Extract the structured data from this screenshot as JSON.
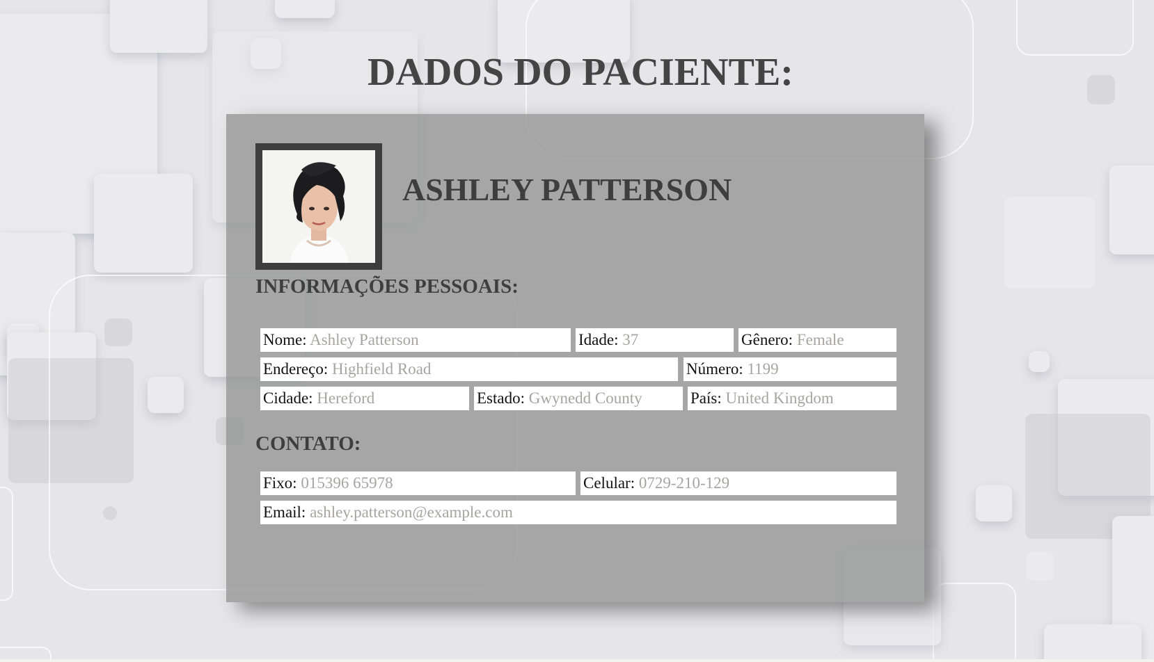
{
  "page": {
    "heading": "DADOS DO PACIENTE:"
  },
  "patient": {
    "full_name": "ASHLEY PATTERSON",
    "photo_alt": "Ashley Patterson"
  },
  "personal": {
    "title": "INFORMAÇÕES PESSOAIS:",
    "nome_label": "Nome:",
    "nome": "Ashley Patterson",
    "idade_label": "Idade:",
    "idade": "37",
    "genero_label": "Gênero:",
    "genero": "Female",
    "endereco_label": "Endereço:",
    "endereco": "Highfield Road",
    "numero_label": "Número:",
    "numero": "1199",
    "cidade_label": "Cidade:",
    "cidade": "Hereford",
    "estado_label": "Estado:",
    "estado": "Gwynedd County",
    "pais_label": "País:",
    "pais": "United Kingdom"
  },
  "contact": {
    "title": "CONTATO:",
    "fixo_label": "Fixo:",
    "fixo": "015396 65978",
    "celular_label": "Celular:",
    "celular": "0729-210-129",
    "email_label": "Email:",
    "email": "ashley.patterson@example.com"
  },
  "colors": {
    "background": "#e6e6e8",
    "card": "#969796",
    "heading_text": "#444444",
    "value_text": "#a8a3a3"
  }
}
